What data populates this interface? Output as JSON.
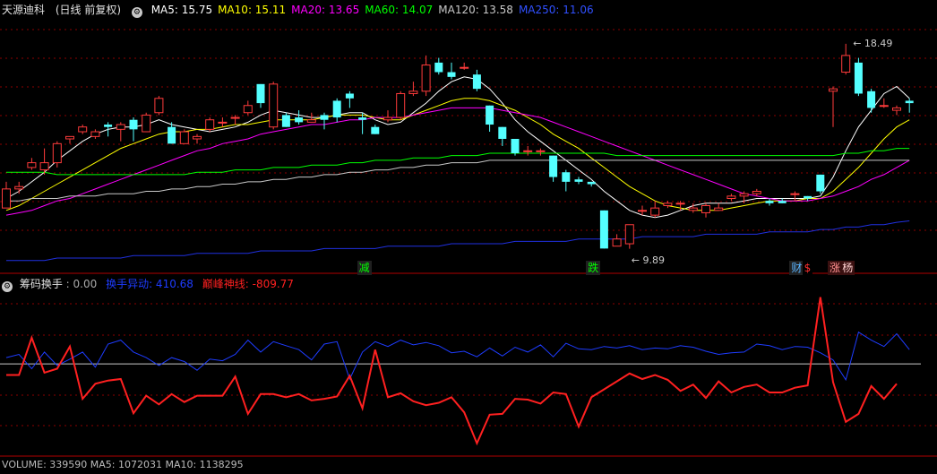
{
  "header": {
    "stock_name": "天源迪科",
    "period": "(日线 前复权)",
    "ma": [
      {
        "label": "MA5: 15.75",
        "color": "#ffffff"
      },
      {
        "label": "MA10: 15.11",
        "color": "#ffff00"
      },
      {
        "label": "MA20: 13.65",
        "color": "#ff00ff"
      },
      {
        "label": "MA60: 14.07",
        "color": "#00ff00"
      },
      {
        "label": "MA120: 13.58",
        "color": "#c8c8c8"
      },
      {
        "label": "MA250: 11.06",
        "color": "#3050ff"
      }
    ]
  },
  "indicator_header": {
    "name": "筹码换手",
    "value": ": 0.00",
    "line1": "换手异动: 410.68",
    "line2": "巅峰神线: -809.77",
    "line1_color": "#1e3cff",
    "line2_color": "#ff2020"
  },
  "bottom_header": {
    "text": "VOLUME: 339590  MA5: 1072031  MA10: 1138295"
  },
  "signals": [
    {
      "text": "减",
      "color": "#00ff00",
      "bg": "#202020",
      "index": 28
    },
    {
      "text": "跌",
      "color": "#00ff00",
      "bg": "#202020",
      "index": 46
    },
    {
      "text": "财",
      "color": "#5ab4ff",
      "bg": "#202020",
      "index": 62
    },
    {
      "text": "$",
      "color": "#ff3030",
      "bg": "#000000",
      "index": 63
    },
    {
      "text": "涨",
      "color": "#ff9090",
      "bg": "#3a1010",
      "index": 65
    },
    {
      "text": "杨",
      "color": "#ffd0d0",
      "bg": "#3a1010",
      "index": 66
    }
  ],
  "chart_data": {
    "type": "candlestick",
    "price_range": [
      9.5,
      19.5
    ],
    "max_label": "18.49",
    "min_label": "9.89",
    "candles": [
      [
        11.6,
        12.4,
        12.7,
        11.6
      ],
      [
        12.4,
        12.5,
        12.7,
        12.2
      ],
      [
        13.3,
        13.5,
        13.7,
        13.2
      ],
      [
        13.2,
        13.5,
        14.1,
        13.0
      ],
      [
        13.5,
        14.3,
        14.4,
        13.3
      ],
      [
        14.5,
        14.6,
        14.6,
        14.3
      ],
      [
        14.8,
        15.0,
        15.1,
        14.7
      ],
      [
        14.6,
        14.8,
        14.9,
        14.5
      ],
      [
        15.1,
        15.0,
        15.2,
        14.6
      ],
      [
        14.9,
        15.1,
        15.2,
        14.4
      ],
      [
        15.3,
        14.9,
        15.4,
        14.4
      ],
      [
        14.8,
        15.5,
        15.6,
        14.8
      ],
      [
        15.6,
        16.2,
        16.3,
        15.5
      ],
      [
        15.0,
        14.3,
        15.2,
        14.3
      ],
      [
        14.3,
        14.8,
        14.9,
        14.3
      ],
      [
        14.5,
        14.6,
        14.7,
        14.3
      ],
      [
        14.9,
        15.3,
        15.4,
        14.8
      ],
      [
        15.2,
        15.2,
        15.4,
        15.0
      ],
      [
        15.4,
        15.4,
        15.5,
        15.1
      ],
      [
        15.6,
        15.9,
        16.1,
        15.5
      ],
      [
        16.8,
        16.0,
        16.8,
        15.8
      ],
      [
        15.0,
        16.8,
        16.9,
        14.9
      ],
      [
        15.5,
        15.0,
        15.6,
        15.0
      ],
      [
        15.4,
        15.2,
        15.7,
        15.1
      ],
      [
        15.2,
        15.3,
        15.6,
        15.2
      ],
      [
        15.5,
        15.3,
        15.6,
        14.9
      ],
      [
        16.1,
        15.4,
        16.2,
        15.2
      ],
      [
        16.4,
        16.2,
        16.5,
        15.8
      ],
      [
        15.4,
        15.3,
        15.6,
        14.7
      ],
      [
        15.0,
        14.7,
        15.1,
        14.7
      ],
      [
        15.3,
        15.4,
        15.7,
        15.2
      ],
      [
        15.4,
        16.4,
        16.5,
        15.3
      ],
      [
        16.4,
        16.5,
        16.9,
        16.3
      ],
      [
        16.5,
        17.6,
        18.0,
        16.3
      ],
      [
        17.7,
        17.3,
        17.9,
        17.2
      ],
      [
        17.3,
        17.1,
        17.7,
        17.0
      ],
      [
        17.5,
        17.5,
        17.7,
        17.4
      ],
      [
        17.2,
        16.6,
        17.4,
        16.5
      ],
      [
        15.9,
        15.1,
        15.9,
        14.8
      ],
      [
        15.0,
        14.5,
        15.0,
        14.2
      ],
      [
        14.5,
        13.9,
        14.5,
        13.8
      ],
      [
        14.0,
        14.0,
        14.2,
        13.8
      ],
      [
        14.0,
        14.0,
        14.1,
        13.8
      ],
      [
        13.8,
        12.9,
        13.8,
        12.7
      ],
      [
        13.1,
        12.7,
        13.2,
        12.3
      ],
      [
        12.8,
        12.7,
        12.9,
        12.6
      ],
      [
        12.7,
        12.6,
        12.7,
        12.5
      ],
      [
        11.5,
        9.9,
        11.5,
        9.9
      ],
      [
        10.0,
        10.3,
        10.5,
        10.2
      ],
      [
        10.1,
        10.9,
        10.9,
        9.89
      ],
      [
        11.5,
        11.5,
        11.7,
        11.3
      ],
      [
        11.3,
        11.6,
        11.9,
        11.2
      ],
      [
        11.7,
        11.8,
        11.9,
        11.6
      ],
      [
        11.8,
        11.8,
        11.9,
        11.5
      ],
      [
        11.5,
        11.6,
        11.8,
        11.4
      ],
      [
        11.4,
        11.7,
        11.8,
        11.2
      ],
      [
        11.5,
        11.6,
        11.8,
        11.5
      ],
      [
        12.0,
        12.1,
        12.2,
        11.9
      ],
      [
        12.1,
        12.2,
        12.3,
        11.8
      ],
      [
        12.2,
        12.3,
        12.4,
        12.1
      ],
      [
        11.9,
        11.8,
        12.0,
        11.7
      ],
      [
        11.9,
        11.8,
        12.0,
        11.8
      ],
      [
        12.2,
        12.2,
        12.3,
        11.9
      ],
      [
        12.1,
        12.0,
        12.1,
        11.9
      ],
      [
        13.0,
        12.3,
        13.0,
        12.2
      ],
      [
        16.5,
        16.6,
        16.7,
        15.0
      ],
      [
        17.3,
        18.0,
        18.49,
        17.2
      ],
      [
        17.7,
        16.4,
        17.9,
        16.3
      ],
      [
        16.5,
        15.8,
        16.6,
        15.6
      ],
      [
        15.9,
        15.9,
        16.2,
        15.8
      ],
      [
        15.7,
        15.8,
        15.9,
        15.5
      ],
      [
        16.1,
        16.0,
        16.2,
        15.6
      ]
    ],
    "ma_series": [
      {
        "name": "MA5",
        "color": "#ffffff",
        "values": [
          12.0,
          12.3,
          12.7,
          13.1,
          13.6,
          14.0,
          14.4,
          14.7,
          14.9,
          15.0,
          15.0,
          15.1,
          15.3,
          15.1,
          15.0,
          14.9,
          14.8,
          14.9,
          15.0,
          15.2,
          15.5,
          15.7,
          15.6,
          15.5,
          15.4,
          15.4,
          15.5,
          15.6,
          15.6,
          15.3,
          15.1,
          15.2,
          15.6,
          16.0,
          16.5,
          16.9,
          17.1,
          17.0,
          16.6,
          16.0,
          15.3,
          14.8,
          14.4,
          14.0,
          13.6,
          13.2,
          12.8,
          12.3,
          11.9,
          11.5,
          11.3,
          11.2,
          11.3,
          11.5,
          11.7,
          11.8,
          11.8,
          11.8,
          11.9,
          12.0,
          12.0,
          12.0,
          12.0,
          12.0,
          12.1,
          12.9,
          14.0,
          15.0,
          15.7,
          16.4,
          16.7,
          16.2
        ]
      },
      {
        "name": "MA10",
        "color": "#ffff00",
        "values": [
          11.5,
          11.7,
          12.0,
          12.3,
          12.6,
          12.9,
          13.2,
          13.5,
          13.8,
          14.1,
          14.3,
          14.5,
          14.7,
          14.8,
          14.8,
          14.9,
          14.9,
          15.0,
          15.1,
          15.1,
          15.2,
          15.3,
          15.3,
          15.3,
          15.3,
          15.4,
          15.5,
          15.5,
          15.5,
          15.4,
          15.3,
          15.3,
          15.5,
          15.7,
          15.9,
          16.1,
          16.2,
          16.2,
          16.1,
          15.9,
          15.7,
          15.4,
          15.1,
          14.7,
          14.4,
          14.1,
          13.7,
          13.3,
          12.9,
          12.5,
          12.2,
          11.9,
          11.7,
          11.6,
          11.5,
          11.5,
          11.5,
          11.6,
          11.7,
          11.8,
          11.9,
          11.9,
          11.9,
          12.0,
          12.0,
          12.3,
          12.8,
          13.3,
          13.9,
          14.5,
          15.0,
          15.3
        ]
      },
      {
        "name": "MA20",
        "color": "#ff00ff",
        "values": [
          11.3,
          11.4,
          11.5,
          11.7,
          11.9,
          12.0,
          12.2,
          12.4,
          12.6,
          12.8,
          13.0,
          13.2,
          13.4,
          13.6,
          13.8,
          14.0,
          14.1,
          14.3,
          14.4,
          14.5,
          14.7,
          14.8,
          14.9,
          15.0,
          15.1,
          15.1,
          15.2,
          15.3,
          15.3,
          15.4,
          15.4,
          15.4,
          15.5,
          15.6,
          15.7,
          15.8,
          15.8,
          15.8,
          15.8,
          15.7,
          15.6,
          15.5,
          15.4,
          15.2,
          15.0,
          14.8,
          14.6,
          14.4,
          14.2,
          14.0,
          13.8,
          13.6,
          13.4,
          13.2,
          13.0,
          12.8,
          12.6,
          12.4,
          12.2,
          12.1,
          12.0,
          11.9,
          11.9,
          11.9,
          12.0,
          12.1,
          12.3,
          12.5,
          12.8,
          13.0,
          13.3,
          13.6
        ]
      },
      {
        "name": "MA60",
        "color": "#00ff00",
        "values": [
          13.1,
          13.1,
          13.1,
          13.1,
          13.0,
          13.0,
          13.0,
          13.0,
          13.0,
          13.0,
          13.0,
          13.0,
          13.0,
          13.0,
          13.0,
          13.1,
          13.1,
          13.1,
          13.2,
          13.2,
          13.2,
          13.3,
          13.3,
          13.3,
          13.4,
          13.4,
          13.4,
          13.5,
          13.5,
          13.6,
          13.6,
          13.6,
          13.7,
          13.7,
          13.7,
          13.8,
          13.8,
          13.8,
          13.9,
          13.9,
          13.9,
          13.9,
          13.9,
          13.9,
          13.9,
          13.9,
          13.9,
          13.9,
          13.8,
          13.8,
          13.8,
          13.8,
          13.8,
          13.8,
          13.8,
          13.8,
          13.8,
          13.8,
          13.8,
          13.8,
          13.8,
          13.8,
          13.8,
          13.8,
          13.8,
          13.8,
          13.9,
          13.9,
          14.0,
          14.0,
          14.1,
          14.1
        ]
      },
      {
        "name": "MA120",
        "color": "#c8c8c8",
        "values": [
          11.9,
          11.9,
          12.0,
          12.0,
          12.0,
          12.1,
          12.1,
          12.1,
          12.2,
          12.2,
          12.2,
          12.3,
          12.3,
          12.4,
          12.4,
          12.5,
          12.5,
          12.6,
          12.6,
          12.7,
          12.7,
          12.8,
          12.8,
          12.9,
          12.9,
          13.0,
          13.0,
          13.1,
          13.1,
          13.2,
          13.2,
          13.3,
          13.3,
          13.4,
          13.4,
          13.5,
          13.5,
          13.5,
          13.6,
          13.6,
          13.6,
          13.6,
          13.6,
          13.6,
          13.6,
          13.6,
          13.6,
          13.6,
          13.6,
          13.6,
          13.6,
          13.6,
          13.6,
          13.6,
          13.6,
          13.6,
          13.6,
          13.6,
          13.6,
          13.6,
          13.6,
          13.6,
          13.6,
          13.6,
          13.6,
          13.6,
          13.6,
          13.6,
          13.6,
          13.6,
          13.6,
          13.6
        ]
      },
      {
        "name": "MA250",
        "color": "#2030e0",
        "values": [
          9.4,
          9.4,
          9.4,
          9.4,
          9.5,
          9.5,
          9.5,
          9.5,
          9.5,
          9.5,
          9.6,
          9.6,
          9.6,
          9.6,
          9.6,
          9.7,
          9.7,
          9.7,
          9.7,
          9.7,
          9.8,
          9.8,
          9.8,
          9.8,
          9.8,
          9.9,
          9.9,
          9.9,
          9.9,
          9.9,
          10.0,
          10.0,
          10.0,
          10.0,
          10.0,
          10.1,
          10.1,
          10.1,
          10.1,
          10.1,
          10.2,
          10.2,
          10.2,
          10.2,
          10.2,
          10.3,
          10.3,
          10.3,
          10.3,
          10.3,
          10.4,
          10.4,
          10.4,
          10.4,
          10.4,
          10.5,
          10.5,
          10.5,
          10.5,
          10.5,
          10.6,
          10.6,
          10.6,
          10.6,
          10.7,
          10.7,
          10.8,
          10.8,
          10.9,
          10.9,
          11.0,
          11.06
        ]
      }
    ],
    "indicator": {
      "range": [
        -1150,
        950
      ],
      "zero": 0,
      "blue": [
        80,
        120,
        -60,
        150,
        -20,
        60,
        150,
        -40,
        250,
        300,
        150,
        80,
        -20,
        80,
        30,
        -80,
        60,
        40,
        120,
        300,
        150,
        280,
        230,
        180,
        50,
        250,
        280,
        -190,
        150,
        280,
        220,
        300,
        240,
        270,
        230,
        140,
        160,
        90,
        200,
        100,
        210,
        150,
        240,
        90,
        260,
        190,
        180,
        220,
        200,
        230,
        180,
        200,
        190,
        230,
        210,
        160,
        120,
        140,
        150,
        250,
        230,
        180,
        220,
        210,
        140,
        50,
        -200,
        400,
        300,
        220,
        380,
        180
      ],
      "red": [
        -140,
        -140,
        330,
        -110,
        -60,
        220,
        -440,
        -250,
        -210,
        -190,
        -620,
        -400,
        -510,
        -380,
        -480,
        -400,
        -400,
        -400,
        -160,
        -630,
        -380,
        -380,
        -420,
        -380,
        -460,
        -440,
        -410,
        -150,
        -560,
        180,
        -420,
        -370,
        -470,
        -520,
        -490,
        -420,
        -610,
        -1000,
        -640,
        -630,
        -440,
        -450,
        -500,
        -360,
        -380,
        -790,
        -420,
        -320,
        -220,
        -120,
        -190,
        -140,
        -200,
        -340,
        -260,
        -430,
        -220,
        -360,
        -290,
        -260,
        -360,
        -360,
        -300,
        -270,
        840,
        -230,
        -730,
        -630,
        -280,
        -440,
        -250
      ]
    }
  }
}
